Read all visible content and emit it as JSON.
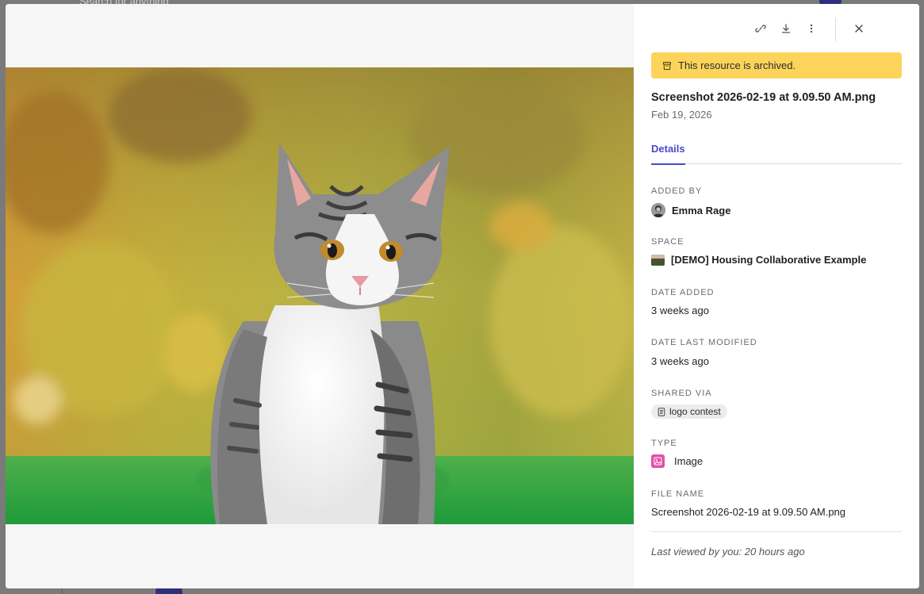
{
  "background": {
    "search_placeholder": "Search for anything"
  },
  "panel": {
    "archived_text": "This resource is archived.",
    "file_title": "Screenshot 2026-02-19 at 9.09.50 AM.png",
    "file_date": "Feb 19, 2026",
    "tab_details": "Details",
    "added_by_label": "ADDED BY",
    "added_by_value": "Emma Rage",
    "space_label": "SPACE",
    "space_value": "[DEMO] Housing Collaborative Example",
    "date_added_label": "DATE ADDED",
    "date_added_value": "3 weeks ago",
    "date_modified_label": "DATE LAST MODIFIED",
    "date_modified_value": "3 weeks ago",
    "shared_via_label": "SHARED VIA",
    "shared_via_value": "logo contest",
    "type_label": "TYPE",
    "type_value": "Image",
    "file_name_label": "FILE NAME",
    "file_name_value": "Screenshot 2026-02-19 at 9.09.50 AM.png",
    "last_viewed": "Last viewed by you: 20 hours ago"
  },
  "toolbar_icons": [
    "link-icon",
    "download-icon",
    "more-vertical-icon",
    "close-icon"
  ],
  "colors": {
    "archived_banner": "#fcd45c",
    "accent": "#4a4ac9",
    "type_icon_bg": "#e44fa7"
  }
}
